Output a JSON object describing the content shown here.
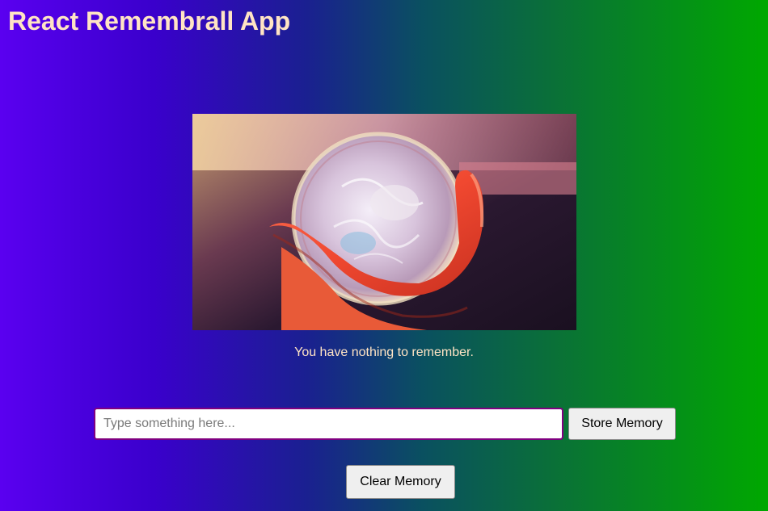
{
  "app": {
    "title": "React Remembrall App"
  },
  "hero": {
    "image_subject": "hand holding a glass remembrall orb with swirling smoke"
  },
  "status": {
    "message": "You have nothing to remember."
  },
  "memory_form": {
    "input_value": "",
    "input_placeholder": "Type something here...",
    "store_label": "Store Memory",
    "clear_label": "Clear Memory"
  },
  "colors": {
    "gradient_left": "#5a00f0",
    "gradient_right": "#00a800",
    "title_text": "#ffe4c4",
    "input_border": "#800080",
    "button_bg": "#efefef"
  }
}
